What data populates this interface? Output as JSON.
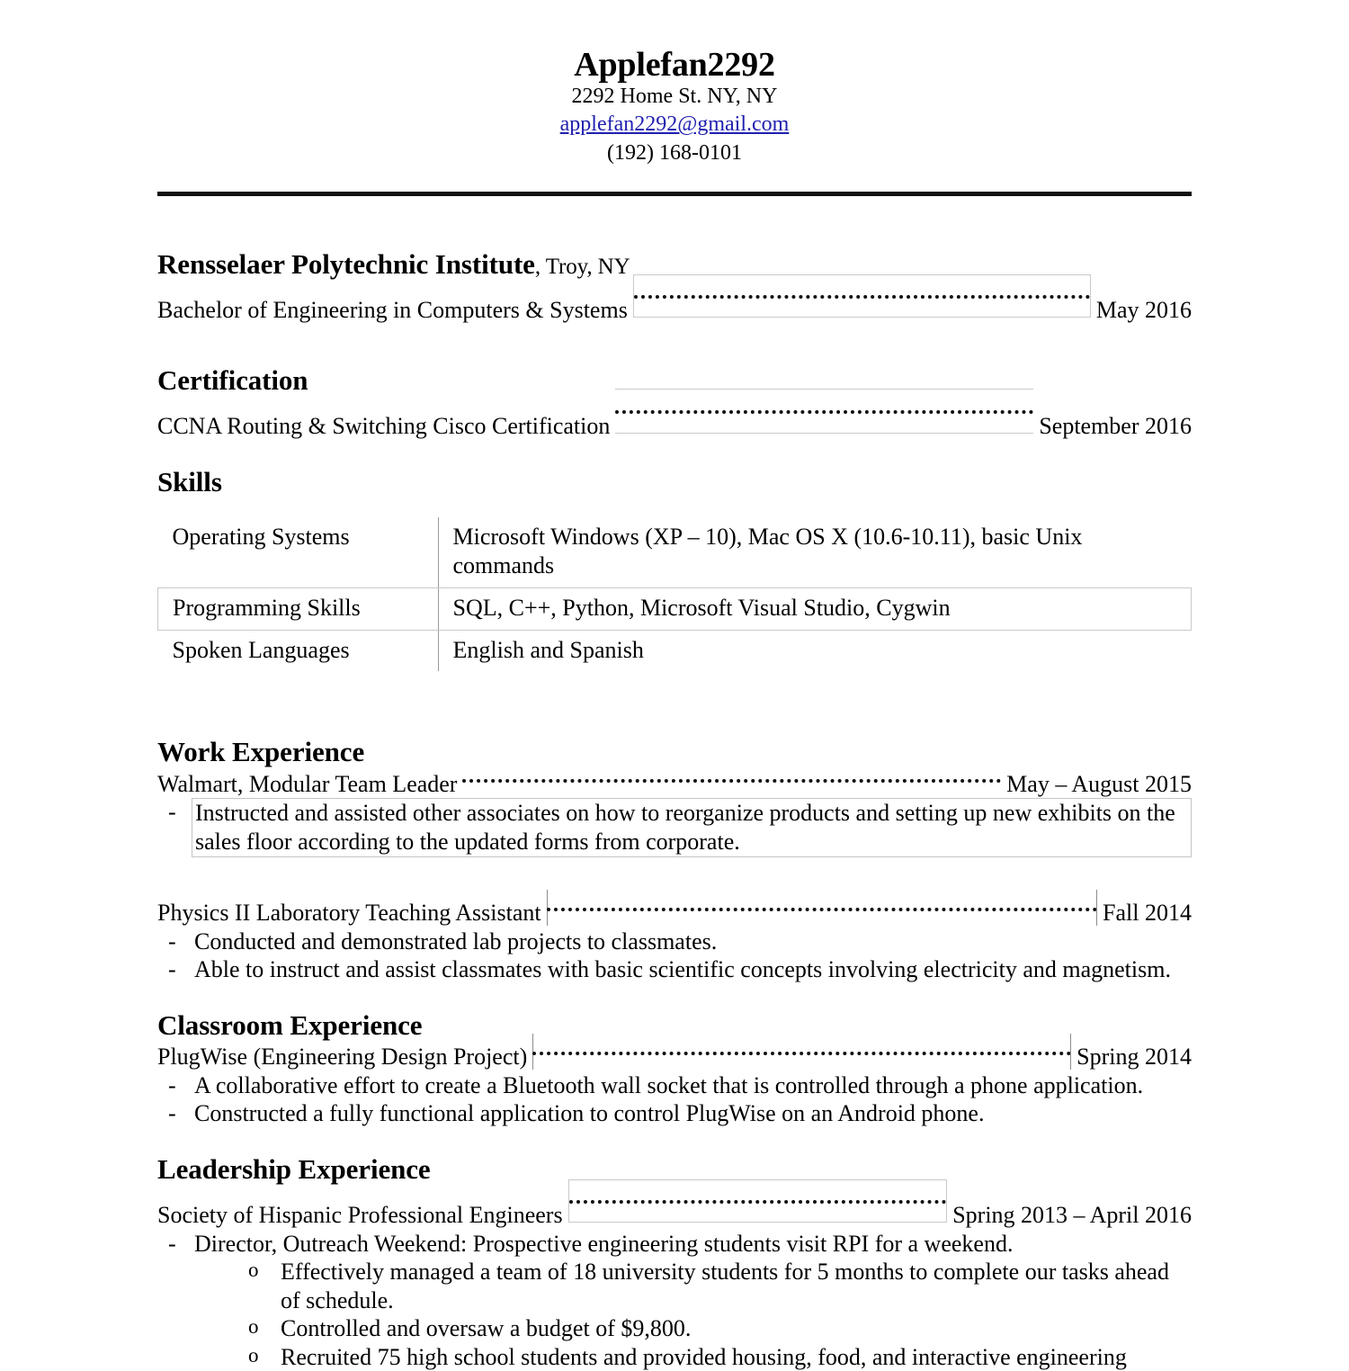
{
  "header": {
    "name": "Applefan2292",
    "address": "2292 Home St. NY, NY",
    "email": "applefan2292@gmail.com",
    "phone": "(192) 168-0101"
  },
  "education": {
    "school": "Rensselaer Polytechnic Institute",
    "location": ", Troy, NY",
    "degree": "Bachelor of Engineering in Computers & Systems",
    "date": "May 2016"
  },
  "certification": {
    "heading": "Certification",
    "title": "CCNA Routing & Switching Cisco Certification",
    "date": "September 2016"
  },
  "skills": {
    "heading": "Skills",
    "rows": [
      {
        "label": "Operating Systems",
        "value": "Microsoft Windows (XP – 10), Mac OS X (10.6-10.11), basic Unix commands"
      },
      {
        "label": "Programming Skills",
        "value": "SQL, C++, Python, Microsoft Visual Studio, Cygwin"
      },
      {
        "label": "Spoken Languages",
        "value": "English and Spanish"
      }
    ]
  },
  "work_experience": {
    "heading": "Work Experience",
    "entries": [
      {
        "title": "Walmart, Modular Team Leader",
        "date": "May – August 2015",
        "bullets": [
          "Instructed and assisted other associates on how to reorganize products and setting up new exhibits on the sales floor according to the updated forms from corporate."
        ]
      },
      {
        "title": "Physics II Laboratory Teaching Assistant",
        "date": "Fall 2014",
        "bullets": [
          "Conducted and demonstrated lab projects to classmates.",
          "Able to instruct and assist classmates with basic scientific concepts involving electricity and magnetism."
        ]
      }
    ]
  },
  "classroom_experience": {
    "heading": "Classroom Experience",
    "entries": [
      {
        "title": "PlugWise (Engineering Design Project)",
        "date": "Spring 2014",
        "bullets": [
          "A collaborative effort to create a Bluetooth wall socket that is controlled through a phone application.",
          "Constructed a fully functional application to control PlugWise on an Android phone."
        ]
      }
    ]
  },
  "leadership_experience": {
    "heading": "Leadership Experience",
    "entries": [
      {
        "title": "Society of Hispanic Professional Engineers",
        "date": "Spring 2013 – April 2016",
        "bullets": [
          "Director, Outreach Weekend: Prospective engineering students visit RPI for a weekend."
        ],
        "subbullets": [
          "Effectively managed a team of 18 university students for 5 months to complete our tasks ahead of schedule.",
          "Controlled and oversaw a budget of $9,800.",
          "Recruited 75 high school students and provided housing, food, and interactive engineering"
        ]
      }
    ]
  },
  "markers": {
    "dash": "-",
    "circle": "o"
  },
  "colors": {
    "link": "#2020B0",
    "rule": "#111111",
    "faint_border": "#c9c9c9"
  }
}
